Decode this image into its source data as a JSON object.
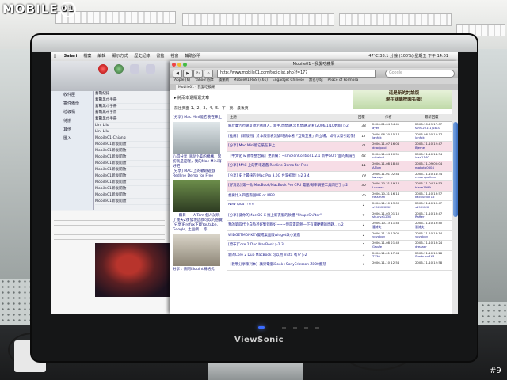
{
  "watermark": {
    "logo_text": "MOBILE",
    "logo_badge": "01",
    "photo_number": "#9"
  },
  "monitor": {
    "brand": "ViewSonic"
  },
  "mac_menubar": {
    "apple_icon": "apple-icon",
    "items": [
      "Safari",
      "檔案",
      "編輯",
      "顯示方式",
      "歷史記錄",
      "書籤",
      "視窗",
      "輔助說明"
    ],
    "status": "47°C  38.1 分鐘  (100%)  星期五 下午 14:01"
  },
  "mail_window": {
    "sidebar": [
      "收件匣",
      "寄件備份",
      "垃圾桶",
      "待辦",
      "其他",
      "匯入"
    ],
    "messages": [
      "奮戰紀錄",
      "奮戰黑巾手冊",
      "奮戰黑巾手冊",
      "奮戰黑巾手冊",
      "奮戰黑巾手冊",
      "Lin, Lilu",
      "Lin, Lilu",
      "Mobile01-Chiang",
      "Mobile01新板開放",
      "Mobile01新板開放",
      "Mobile01新板開放",
      "Mobile01新板開放",
      "Mobile01新板開放",
      "Mobile01新板開放",
      "Mobile01新板開放",
      "Mobile01新板開放",
      "Mobile01新板開放",
      "Mobile01新板開放"
    ]
  },
  "browser": {
    "window_title": "Mobile01 - 我愛吃蘋果",
    "url": "http://www.mobile01.com/topiclist.php?f=177",
    "search_placeholder": "Google",
    "bookmarks": [
      "Apple (6)",
      "Yahoo!奇摩",
      "蘋果網",
      "Mobile01 RSS (461)",
      "Engadget Chinese",
      "無名小站",
      "Peace of Formosa"
    ],
    "tab_label": "Mobile01 - 我愛吃蘋果",
    "section_title": "我愛吃蘋果討論版",
    "nav_text": "▸ 將兩本選購選文章",
    "pages_text": "前往頁面 1、2、3、4、5、下一頁、最後頁",
    "banner_text": "這是新的討論版",
    "banner_sub": "現在就購校園名額!",
    "left_column": [
      "[分享] Mac Mini能它裝在車上",
      "心得分享 說說小美的機構，當初就是是喔，我的Mac Mini寫好吧",
      "[分享] MAC 上的軌跡遊戲 Redline Demo for Free",
      "~~無目~~ A-Tom 個人試玩了幾天Z後發現這款可以的感覺",
      "[分享]Firefox下載Youtube, Google, 土豆網... 等",
      "分享 : 去同iSquint轉格式"
    ],
    "table": {
      "headers": [
        "主題",
        "回覆",
        "作者",
        "最新回覆"
      ],
      "rows": [
        {
          "title": "關於廣告也違反規定請遵入，新手,問問題,常見問題,必看(2006/1/10更新) ▷2",
          "replies": "38",
          "author_date": "2006-01-04 04:41",
          "author": "ayer",
          "last_date": "2006-10-29 17:07",
          "last_by": "s091201(1)1410"
        },
        {
          "title": "[推薦] 【新版用】於本版發表流論時請本著「互敬互重」的立場，如有以發引起爭議，請注意警告",
          "replies": "17",
          "author_date": "2006-06-20 15:17",
          "author": "lanfok",
          "last_date": "2006-06-20 15:17",
          "last_by": "lanfok"
        },
        {
          "title": "[分享] Mac Mini能它裝在車上",
          "replies": "71",
          "author_date": "2006-11-07 16:04",
          "author": "deadpool",
          "last_date": "2006-11-10 12:47",
          "last_by": "Bjeme"
        },
        {
          "title": "【中文化 & 教學整合篇】更新欄：~smcFanControl 1.2.1 新中GUI介面的風扇控制軟體... ▷2 3",
          "replies": "42",
          "author_date": "2006-11-04 20:51",
          "author": "catwind",
          "last_date": "2006-11-10 14:34",
          "last_by": "ivan1140"
        },
        {
          "title": "[分享] MAC 上的賽車遊戲 Redline Demo for Free",
          "replies": "11",
          "author_date": "2006-11-08 18:40",
          "author": "A-Tom",
          "last_date": "2006-11-09 00:04",
          "last_by": "makoto0604"
        },
        {
          "title": "[分享] 史上最快的 Mac Pro 3.0G 台灣初現! ▷2 3 4",
          "replies": "79",
          "author_date": "2006-11-01 02:44",
          "author": "loveapr",
          "last_date": "2006-11-10 14:34",
          "last_by": "chuangwillam"
        },
        {
          "title": "[好消息] 第一款 MacBook/MacBook Pro CPU 電壓/頻率調整工具問世了 ▷2",
          "replies": "30",
          "author_date": "2006-10-31 19:16",
          "author": "Luccass",
          "last_date": "2006-11-04 19:53",
          "last_by": "blaze1999"
        },
        {
          "title": "想要比入四百兩個MB or MBP.......",
          "replies": "26",
          "author_date": "2006-10-31 16:14",
          "author": "rossman",
          "last_date": "2006-11-10 13:57",
          "last_by": "kachuei0716"
        },
        {
          "title": "New ipod !!?!?!",
          "replies": "2",
          "author_date": "2006-11-10 13:03",
          "author": "s19XXXXXX",
          "last_date": "2006-11-10 13:47",
          "last_by": "s19XXXX"
        },
        {
          "title": "[分享] 讓你的Mac OS X 擁上新衣服的軟體 \"ShapeShifter\"",
          "replies": "9",
          "author_date": "2006-11-03 01:15",
          "author": "shuuya1230",
          "last_date": "2006-11-10 13:47",
          "last_by": "Rafter"
        },
        {
          "title": "我的第四代小白為甚好對到啊好~~~但是還是熱一下有關硬體的問題... ▷2",
          "replies": "2",
          "author_date": "2006-10-13 11:46",
          "author": "瀋博夫",
          "last_date": "2006-11-10 13:40",
          "last_by": "瀋博夫"
        },
        {
          "title": "WIDGETMONKEY變成桌面版widget改小遊戲",
          "replies": "2",
          "author_date": "2006-11-10 13:02",
          "author": "yoyoboy",
          "last_date": "2006-11-10 13:14",
          "last_by": "yoyoboy"
        },
        {
          "title": "[發布]Core 2 Duo MacBook ▷2 3",
          "replies": "5",
          "author_date": "2006-11-08 21:43",
          "author": "Gwufe",
          "last_date": "2006-11-10 13:24",
          "last_by": "dreaaer"
        },
        {
          "title": "新的Core 2 Duo MacBook 可以用 Vista 嗎?? ▷2",
          "replies": "3",
          "author_date": "2006-11-01 17:44",
          "author": "TX30",
          "last_date": "2006-11-10 13:28",
          "last_by": "Starbuxx4X4"
        },
        {
          "title": "【教學分享陳列本】蘋果電腦iBook+SonyEricsson Z800藍芽",
          "replies": "1",
          "author_date": "2006-11-10 12:54",
          "author": "",
          "last_date": "2006-11-10 12:58",
          "last_by": ""
        }
      ]
    }
  },
  "colors": {
    "bezel": "#151617",
    "accent_blue": "#3a6fc2",
    "pink_row": "#f7dde6",
    "link": "#1b1b8a"
  }
}
